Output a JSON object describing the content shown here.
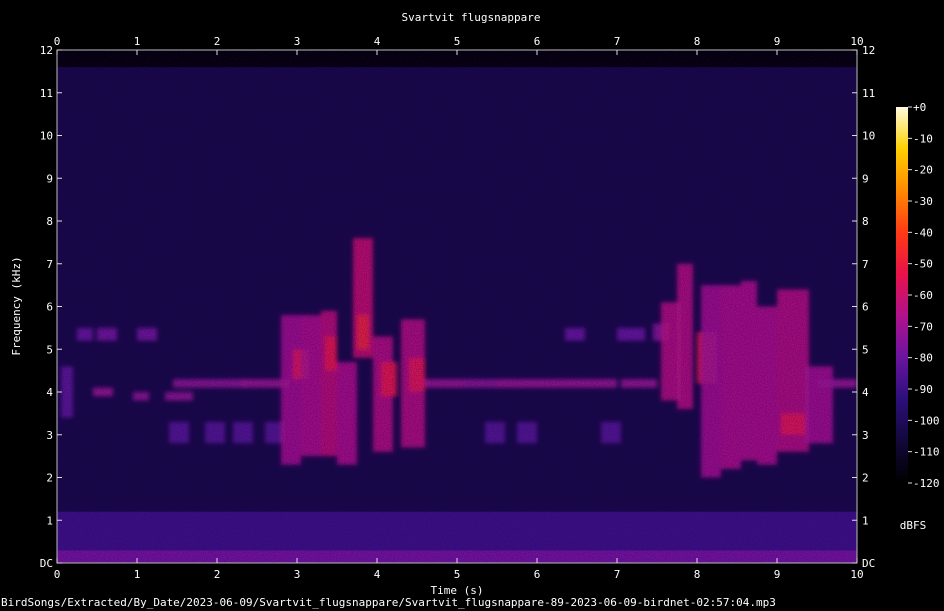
{
  "chart_data": {
    "type": "heatmap",
    "title": "Svartvit flugsnappare",
    "xlabel": "Time (s)",
    "ylabel": "Frequency (kHz)",
    "xlim": [
      0,
      10
    ],
    "ylim": [
      0,
      12
    ],
    "x_ticks": [
      "0",
      "1",
      "2",
      "3",
      "4",
      "5",
      "6",
      "7",
      "8",
      "9",
      "10"
    ],
    "y_ticks": [
      "DC",
      "1",
      "2",
      "3",
      "4",
      "5",
      "6",
      "7",
      "8",
      "9",
      "10",
      "11",
      "12"
    ],
    "colorbar": {
      "label": "dBFS",
      "range": [
        -120,
        0
      ],
      "ticks": [
        "+0",
        "-10",
        "-20",
        "-30",
        "-40",
        "-50",
        "-60",
        "-70",
        "-80",
        "-90",
        "-100",
        "-110",
        "-120"
      ],
      "colors": [
        "#000000",
        "#12083a",
        "#2c0f7a",
        "#6a14a0",
        "#b0128c",
        "#e8124a",
        "#ff3a14",
        "#ff8a00",
        "#ffd000",
        "#fffbe0"
      ]
    },
    "content_bands": [
      {
        "f_low": 0,
        "f_high": 11.6,
        "t_start": 0,
        "t_end": 10,
        "level_db": -105
      },
      {
        "f_low": 0,
        "f_high": 0.3,
        "t_start": 0,
        "t_end": 10,
        "level_db": -78
      },
      {
        "f_low": 0.3,
        "f_high": 1.2,
        "t_start": 0,
        "t_end": 10,
        "level_db": -90
      }
    ],
    "events": [
      {
        "t_start": 0.05,
        "t_end": 0.2,
        "f_low": 3.4,
        "f_high": 4.6,
        "level_db": -82
      },
      {
        "t_start": 0.25,
        "t_end": 0.45,
        "f_low": 5.2,
        "f_high": 5.5,
        "level_db": -80
      },
      {
        "t_start": 0.45,
        "t_end": 0.7,
        "f_low": 3.9,
        "f_high": 4.1,
        "level_db": -70
      },
      {
        "t_start": 0.5,
        "t_end": 0.75,
        "f_low": 5.2,
        "f_high": 5.5,
        "level_db": -78
      },
      {
        "t_start": 0.95,
        "t_end": 1.15,
        "f_low": 3.8,
        "f_high": 4.0,
        "level_db": -72
      },
      {
        "t_start": 1.0,
        "t_end": 1.25,
        "f_low": 5.2,
        "f_high": 5.5,
        "level_db": -78
      },
      {
        "t_start": 1.35,
        "t_end": 1.7,
        "f_low": 3.8,
        "f_high": 4.0,
        "level_db": -72
      },
      {
        "t_start": 1.4,
        "t_end": 1.65,
        "f_low": 2.8,
        "f_high": 3.3,
        "level_db": -84
      },
      {
        "t_start": 1.45,
        "t_end": 1.9,
        "f_low": 4.1,
        "f_high": 4.3,
        "level_db": -72
      },
      {
        "t_start": 1.85,
        "t_end": 2.1,
        "f_low": 2.8,
        "f_high": 3.3,
        "level_db": -84
      },
      {
        "t_start": 1.9,
        "t_end": 2.4,
        "f_low": 4.1,
        "f_high": 4.3,
        "level_db": -72
      },
      {
        "t_start": 2.2,
        "t_end": 2.45,
        "f_low": 2.8,
        "f_high": 3.3,
        "level_db": -84
      },
      {
        "t_start": 2.3,
        "t_end": 2.9,
        "f_low": 4.1,
        "f_high": 4.3,
        "level_db": -70
      },
      {
        "t_start": 2.6,
        "t_end": 2.85,
        "f_low": 2.8,
        "f_high": 3.3,
        "level_db": -84
      },
      {
        "t_start": 2.8,
        "t_end": 3.05,
        "f_low": 2.3,
        "f_high": 5.8,
        "level_db": -68
      },
      {
        "t_start": 2.95,
        "t_end": 3.15,
        "f_low": 4.3,
        "f_high": 5.0,
        "level_db": -55
      },
      {
        "t_start": 3.05,
        "t_end": 3.3,
        "f_low": 2.5,
        "f_high": 5.8,
        "level_db": -66
      },
      {
        "t_start": 3.3,
        "t_end": 3.5,
        "f_low": 2.5,
        "f_high": 5.9,
        "level_db": -62
      },
      {
        "t_start": 3.35,
        "t_end": 3.5,
        "f_low": 4.5,
        "f_high": 5.3,
        "level_db": -52
      },
      {
        "t_start": 3.5,
        "t_end": 3.75,
        "f_low": 2.3,
        "f_high": 4.7,
        "level_db": -66
      },
      {
        "t_start": 3.7,
        "t_end": 3.95,
        "f_low": 4.8,
        "f_high": 7.6,
        "level_db": -60
      },
      {
        "t_start": 3.75,
        "t_end": 3.9,
        "f_low": 5.0,
        "f_high": 5.8,
        "level_db": -48
      },
      {
        "t_start": 3.95,
        "t_end": 4.2,
        "f_low": 2.6,
        "f_high": 5.3,
        "level_db": -64
      },
      {
        "t_start": 4.05,
        "t_end": 4.25,
        "f_low": 3.9,
        "f_high": 4.7,
        "level_db": -52
      },
      {
        "t_start": 4.3,
        "t_end": 4.6,
        "f_low": 2.7,
        "f_high": 5.7,
        "level_db": -64
      },
      {
        "t_start": 4.4,
        "t_end": 4.6,
        "f_low": 4.0,
        "f_high": 4.8,
        "level_db": -54
      },
      {
        "t_start": 4.6,
        "t_end": 5.1,
        "f_low": 4.1,
        "f_high": 4.3,
        "level_db": -70
      },
      {
        "t_start": 5.1,
        "t_end": 5.5,
        "f_low": 4.1,
        "f_high": 4.3,
        "level_db": -72
      },
      {
        "t_start": 5.35,
        "t_end": 5.6,
        "f_low": 2.8,
        "f_high": 3.3,
        "level_db": -84
      },
      {
        "t_start": 5.5,
        "t_end": 6.0,
        "f_low": 4.1,
        "f_high": 4.3,
        "level_db": -70
      },
      {
        "t_start": 5.75,
        "t_end": 6.0,
        "f_low": 2.8,
        "f_high": 3.3,
        "level_db": -84
      },
      {
        "t_start": 6.0,
        "t_end": 6.5,
        "f_low": 4.1,
        "f_high": 4.3,
        "level_db": -70
      },
      {
        "t_start": 6.35,
        "t_end": 6.6,
        "f_low": 5.2,
        "f_high": 5.5,
        "level_db": -80
      },
      {
        "t_start": 6.5,
        "t_end": 7.0,
        "f_low": 4.1,
        "f_high": 4.3,
        "level_db": -70
      },
      {
        "t_start": 6.8,
        "t_end": 7.05,
        "f_low": 2.8,
        "f_high": 3.3,
        "level_db": -84
      },
      {
        "t_start": 7.0,
        "t_end": 7.35,
        "f_low": 5.2,
        "f_high": 5.5,
        "level_db": -80
      },
      {
        "t_start": 7.05,
        "t_end": 7.5,
        "f_low": 4.1,
        "f_high": 4.3,
        "level_db": -70
      },
      {
        "t_start": 7.45,
        "t_end": 7.65,
        "f_low": 5.2,
        "f_high": 5.6,
        "level_db": -74
      },
      {
        "t_start": 7.55,
        "t_end": 7.8,
        "f_low": 3.8,
        "f_high": 6.1,
        "level_db": -64
      },
      {
        "t_start": 7.75,
        "t_end": 7.95,
        "f_low": 3.6,
        "f_high": 7.0,
        "level_db": -64
      },
      {
        "t_start": 8.0,
        "t_end": 8.25,
        "f_low": 4.2,
        "f_high": 5.4,
        "level_db": -52
      },
      {
        "t_start": 8.05,
        "t_end": 8.3,
        "f_low": 2.0,
        "f_high": 6.5,
        "level_db": -68
      },
      {
        "t_start": 8.3,
        "t_end": 8.55,
        "f_low": 2.2,
        "f_high": 6.5,
        "level_db": -66
      },
      {
        "t_start": 8.55,
        "t_end": 8.75,
        "f_low": 2.4,
        "f_high": 6.6,
        "level_db": -66
      },
      {
        "t_start": 8.75,
        "t_end": 9.0,
        "f_low": 2.3,
        "f_high": 6.0,
        "level_db": -66
      },
      {
        "t_start": 9.0,
        "t_end": 9.4,
        "f_low": 2.6,
        "f_high": 6.4,
        "level_db": -64
      },
      {
        "t_start": 9.05,
        "t_end": 9.35,
        "f_low": 3.0,
        "f_high": 3.5,
        "level_db": -54
      },
      {
        "t_start": 9.35,
        "t_end": 9.7,
        "f_low": 2.8,
        "f_high": 4.6,
        "level_db": -68
      },
      {
        "t_start": 9.5,
        "t_end": 10.0,
        "f_low": 4.1,
        "f_high": 4.3,
        "level_db": -70
      }
    ]
  },
  "footer": {
    "path": "BirdSongs/Extracted/By_Date/2023-06-09/Svartvit_flugsnappare/Svartvit_flugsnappare-89-2023-06-09-birdnet-02:57:04.mp3"
  }
}
